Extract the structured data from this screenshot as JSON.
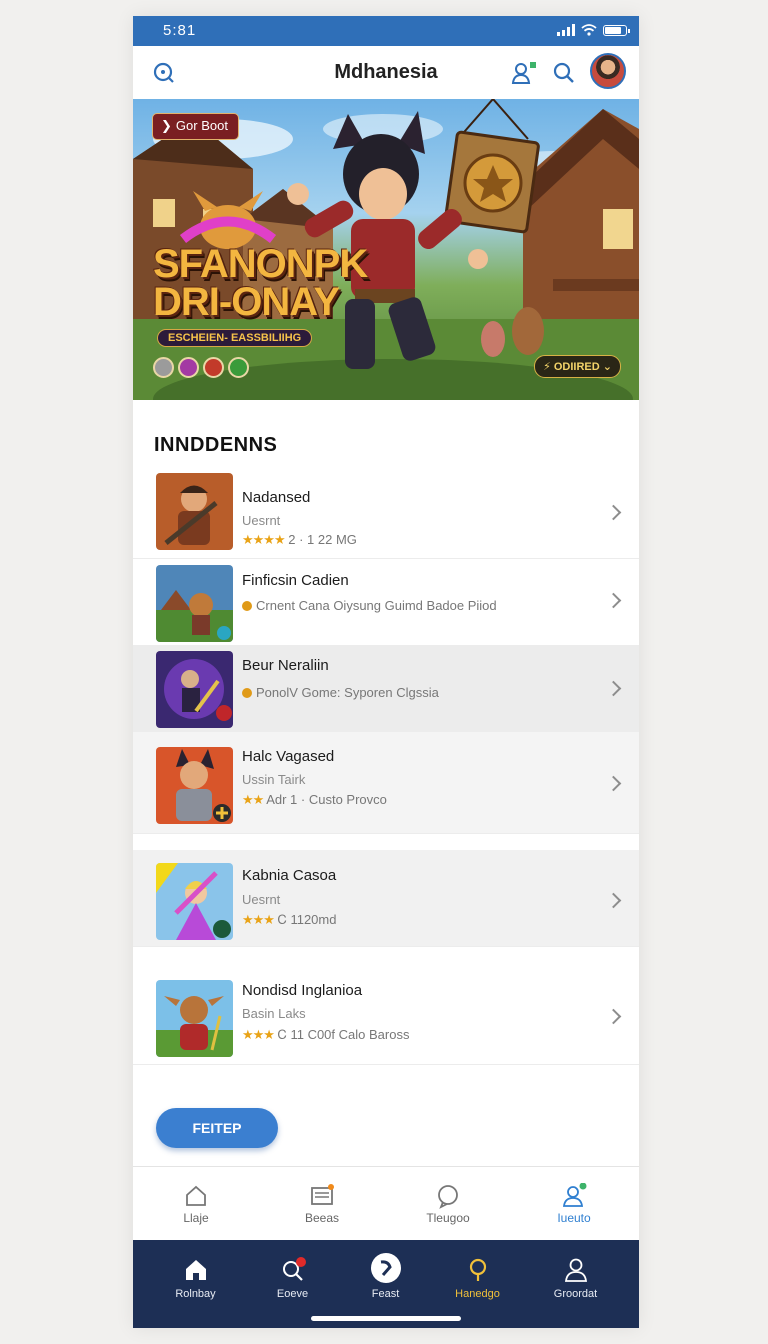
{
  "status_bar": {
    "time": "5:81"
  },
  "header": {
    "title": "Mdhanesia"
  },
  "hero": {
    "badge": "Gor Boot",
    "title_line1": "SFANONPK",
    "title_line2": "DRI-ONAY",
    "subtitle": "ESCHEIEN-  EASSBILIIHG",
    "cta": "ODIIRED"
  },
  "section": {
    "title": "INNDDENNS"
  },
  "list": [
    {
      "title": "Nadansed",
      "subtitle": "Uesrnt",
      "stars": "★★★★",
      "meta": "2 · 1 22 MG",
      "icon": "warrior-thumbnail"
    },
    {
      "title": "Finficsin Cadien",
      "meta": "Crnent Cana Oiysung Guimd Badoe Piiod",
      "icon": "village-thumbnail"
    },
    {
      "title": "Beur Neraliin",
      "meta": "PonolV Gome: Syporen Clgssia",
      "icon": "mage-thumbnail"
    },
    {
      "title": "Halc Vagased",
      "subtitle": "Ussin Tairk",
      "stars": "★★",
      "meta": "Adr 1 · Custo Provco",
      "icon": "knight-thumbnail"
    },
    {
      "title": "Kabnia Casoa",
      "subtitle": "Uesrnt",
      "stars": "★★★",
      "meta": "Ꮯ 1120md",
      "icon": "fairy-thumbnail"
    },
    {
      "title": "Nondisd Inglanioa",
      "subtitle": "Basin Laks",
      "stars": "★★★",
      "meta": "Ꮯ 11 C00f Calo Baross",
      "icon": "goblin-thumbnail"
    }
  ],
  "fab": {
    "label": "FEITEP"
  },
  "tabs_top": [
    {
      "label": "Llaje",
      "icon": "home-outline-icon"
    },
    {
      "label": "Beeas",
      "icon": "news-icon"
    },
    {
      "label": "Tleugoo",
      "icon": "chat-icon"
    },
    {
      "label": "Iueuto",
      "icon": "profile-icon"
    }
  ],
  "tabs_bottom": [
    {
      "label": "Rolnbay",
      "icon": "home-icon"
    },
    {
      "label": "Eoeve",
      "icon": "search-icon"
    },
    {
      "label": "Feast",
      "icon": "feast-icon"
    },
    {
      "label": "Hanedgo",
      "icon": "pin-icon"
    },
    {
      "label": "Groordat",
      "icon": "account-icon"
    }
  ],
  "colors": {
    "accent": "#2f6fb8",
    "fab": "#3b7fd0",
    "bottom_nav": "#1d2f55",
    "star": "#e9a317",
    "active_tab_top": "#2f7fd0",
    "active_tab_bottom": "#f0c03a"
  }
}
